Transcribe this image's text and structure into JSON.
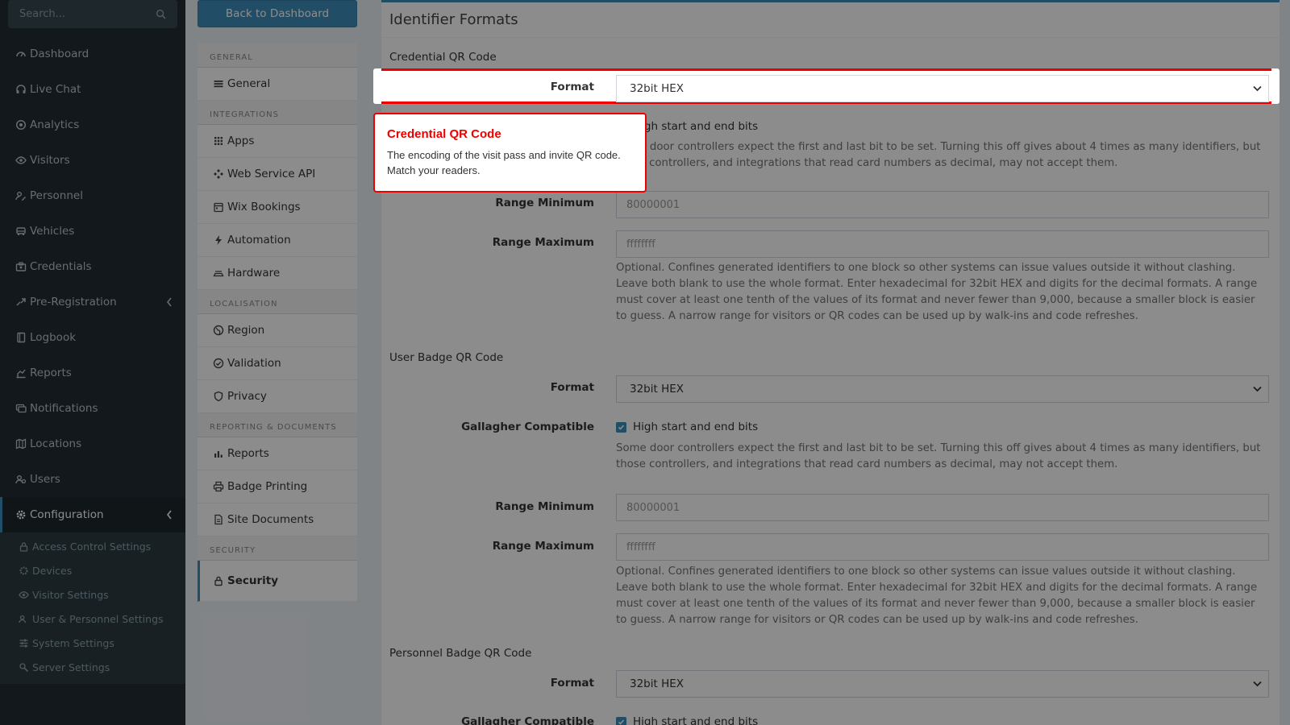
{
  "search": {
    "placeholder": "Search..."
  },
  "sidebar": {
    "items": [
      {
        "label": "Dashboard",
        "icon": "dashboard-icon"
      },
      {
        "label": "Live Chat",
        "icon": "headset-icon"
      },
      {
        "label": "Analytics",
        "icon": "analytics-icon"
      },
      {
        "label": "Visitors",
        "icon": "eye-icon"
      },
      {
        "label": "Personnel",
        "icon": "personnel-icon"
      },
      {
        "label": "Vehicles",
        "icon": "vehicle-icon"
      },
      {
        "label": "Credentials",
        "icon": "credentials-icon"
      },
      {
        "label": "Pre-Registration",
        "icon": "pre-registration-icon"
      },
      {
        "label": "Logbook",
        "icon": "logbook-icon"
      },
      {
        "label": "Reports",
        "icon": "reports-icon"
      },
      {
        "label": "Notifications",
        "icon": "notifications-icon"
      },
      {
        "label": "Locations",
        "icon": "map-icon"
      },
      {
        "label": "Users",
        "icon": "users-icon"
      },
      {
        "label": "Configuration",
        "icon": "gear-icon"
      }
    ],
    "sub_items": [
      {
        "label": "Access Control Settings",
        "icon": "lock-icon"
      },
      {
        "label": "Devices",
        "icon": "devices-icon"
      },
      {
        "label": "Visitor Settings",
        "icon": "eye-icon"
      },
      {
        "label": "User & Personnel Settings",
        "icon": "users-icon"
      },
      {
        "label": "System Settings",
        "icon": "sliders-icon"
      },
      {
        "label": "Server Settings",
        "icon": "server-icon"
      }
    ]
  },
  "settings_menu": {
    "back_label": "Back to Dashboard",
    "general_head": "GENERAL",
    "general": "General",
    "integrations_head": "INTEGRATIONS",
    "apps": "Apps",
    "web_service_api": "Web Service API",
    "wix_bookings": "Wix Bookings",
    "automation": "Automation",
    "hardware": "Hardware",
    "localisation_head": "LOCALISATION",
    "region": "Region",
    "validation": "Validation",
    "privacy": "Privacy",
    "reporting_head": "REPORTING & DOCUMENTS",
    "reports": "Reports",
    "badge_printing": "Badge Printing",
    "site_documents": "Site Documents",
    "security_head": "SECURITY",
    "security": "Security"
  },
  "main": {
    "title": "Identifier Formats",
    "format_label": "Format",
    "gallagher_label": "Gallagher Compatible",
    "range_min_label": "Range Minimum",
    "range_max_label": "Range Maximum",
    "gallagher_check": "High start and end bits",
    "gallagher_check_partial": "h start and end bits",
    "gallagher_help": "Some door controllers expect the first and last bit to be set. Turning this off gives about 4 times as many identifiers, but those controllers, and integrations that read card numbers as decimal, may not accept them.",
    "gallagher_help_line1_partial": "door controllers expect the first and last bit to be set. Turning this off gives about 4 times as many identifiers, but those",
    "gallagher_help_line2_partial": "llers, and integrations that read card numbers as decimal, may not accept them.",
    "range_help": "Optional. Confines generated identifiers to one block so other systems can issue values outside it without clashing. Leave both blank to use the whole format. Enter hexadecimal for 32bit HEX and digits for the decimal formats. A range must cover at least one tenth of the values of its format and never fewer than 9,000, because a smaller block is easier to guess. A narrow range for visitors or QR codes can be used up by walk-ins and code refreshes.",
    "range_min_placeholder": "80000001",
    "range_max_placeholder": "ffffffff",
    "sections": [
      {
        "title": "Credential QR Code",
        "format": "32bit HEX"
      },
      {
        "title": "User Badge QR Code",
        "format": "32bit HEX"
      },
      {
        "title": "Personnel Badge QR Code",
        "format": "32bit HEX"
      }
    ]
  },
  "tour": {
    "title": "Credential QR Code",
    "body": "The encoding of the visit pass and invite QR code. Match your readers."
  },
  "colors": {
    "accent": "#3c8dbc",
    "tour_red": "#e00000",
    "sidebar": "#222d32"
  }
}
